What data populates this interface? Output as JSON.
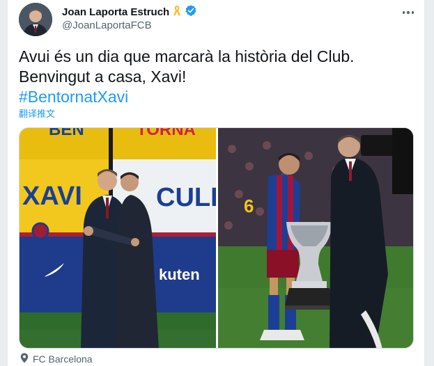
{
  "tweet": {
    "display_name": "Joan Laporta Estruch",
    "handle": "@JoanLaportaFCB",
    "text_line1": "Avui és un dia que marcarà la història del Club.",
    "text_line2": "Benvingut a casa, Xavi!",
    "hashtag": "#BentornatXavi",
    "translate_label": "翻译推文",
    "source_label": "FC Barcelona",
    "photo1_banner_top": "BEN",
    "photo1_banner_top_red": "TORNA",
    "photo1_banner_left": "XAVI",
    "photo1_banner_right": "CULE",
    "photo1_sponsor": "kuten",
    "photo2_shirt_number": "6"
  },
  "icons": {
    "avatar": "profile-photo",
    "ribbon": "yellow-ribbon-icon",
    "verified": "verified-badge-icon",
    "more": "more-options-icon",
    "source": "location-pin-icon"
  },
  "colors": {
    "accent": "#1d9bf0",
    "text": "#0f1419",
    "secondary": "#536471",
    "ribbon": "#f4c430"
  }
}
